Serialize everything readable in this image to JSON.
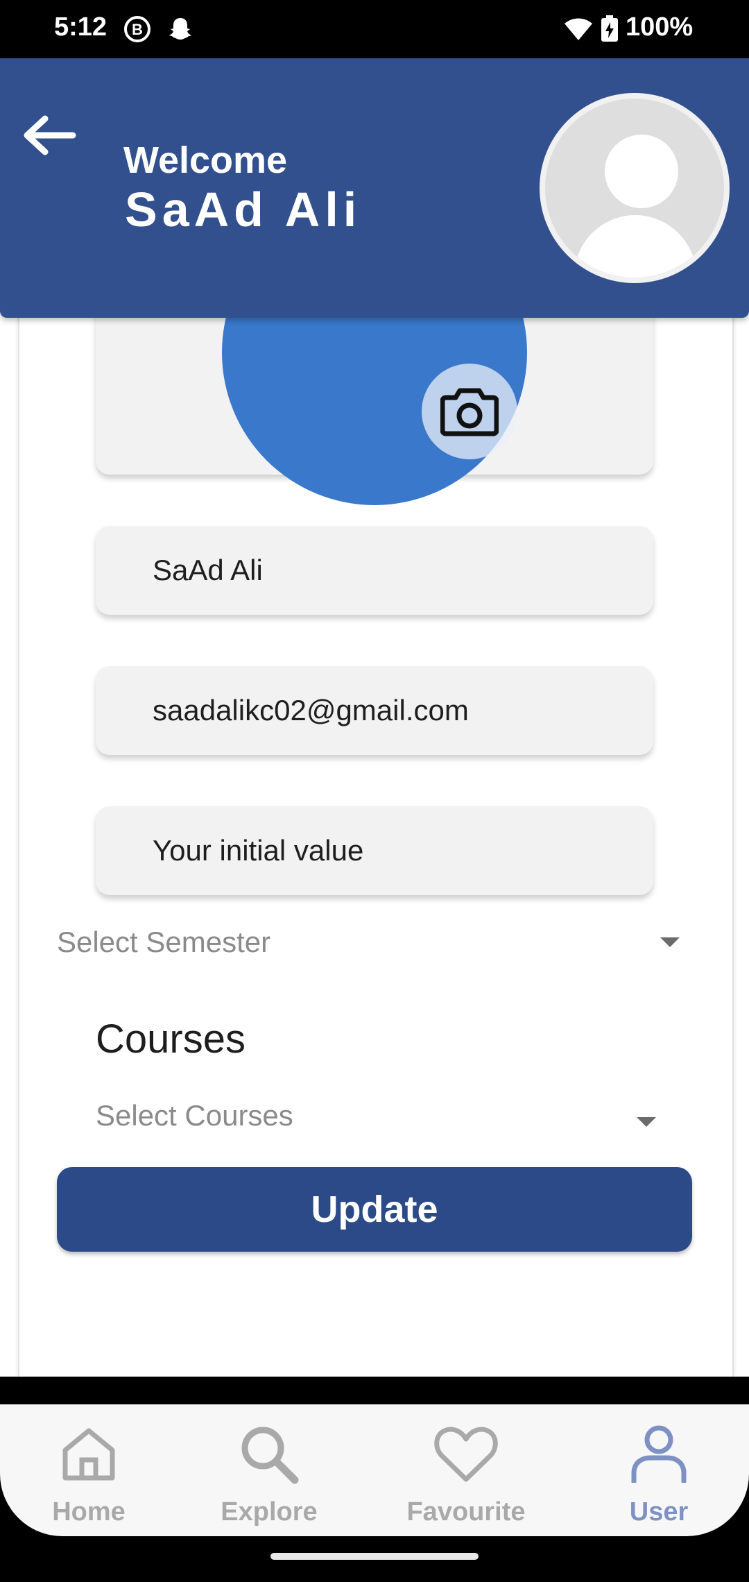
{
  "status_bar": {
    "time": "5:12",
    "battery": "100%",
    "icons": [
      "b-circle-icon",
      "snapchat-icon",
      "wifi-icon",
      "battery-charging-icon"
    ]
  },
  "header": {
    "greeting": "Welcome",
    "name": "SaAd Ali",
    "background_color": "#31508d"
  },
  "profile_form": {
    "name_value": "SaAd Ali",
    "email_value": "saadalikc02@gmail.com",
    "third_value": "Your initial value",
    "semester_placeholder": "Select Semester",
    "courses_title": "Courses",
    "courses_placeholder": "Select Courses",
    "update_label": "Update",
    "accent_color": "#3a78cb",
    "button_color": "#2c4a88"
  },
  "bottom_nav": {
    "items": [
      {
        "label": "Home",
        "icon": "home-icon",
        "active": false
      },
      {
        "label": "Explore",
        "icon": "search-icon",
        "active": false
      },
      {
        "label": "Favourite",
        "icon": "heart-icon",
        "active": false
      },
      {
        "label": "User",
        "icon": "user-icon",
        "active": true
      }
    ],
    "active_color": "#7e91c3"
  }
}
